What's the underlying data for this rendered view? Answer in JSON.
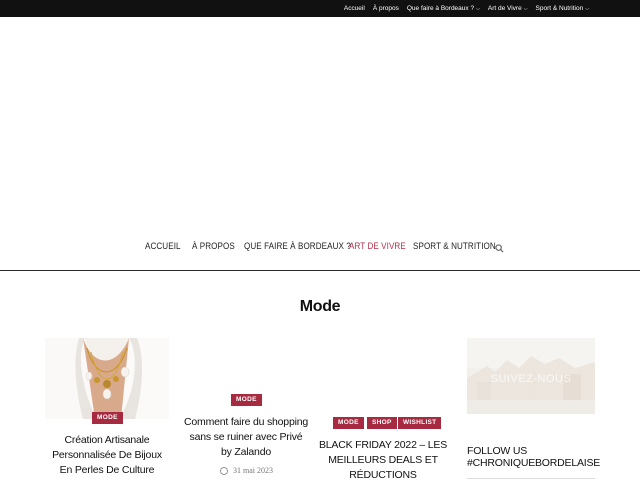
{
  "topbar": {
    "items": [
      {
        "label": "Accueil",
        "has_dropdown": false
      },
      {
        "label": "À propos",
        "has_dropdown": false
      },
      {
        "label": "Que faire à Bordeaux ?",
        "has_dropdown": true
      },
      {
        "label": "Art de Vivre",
        "has_dropdown": true
      },
      {
        "label": "Sport & Nutrition",
        "has_dropdown": true
      }
    ]
  },
  "mainnav": {
    "items": [
      {
        "label": "ACCUEIL"
      },
      {
        "label": "À PROPOS"
      },
      {
        "label": "QUE FAIRE À BORDEAUX ?"
      },
      {
        "label": "ART DE VIVRE",
        "active": true
      },
      {
        "label": "SPORT & NUTRITION"
      }
    ],
    "search_icon": "search-icon"
  },
  "page": {
    "title": "Mode"
  },
  "posts": [
    {
      "tags": [
        "MODE"
      ],
      "title": "Création Artisanale Personnalisée De Bijoux En Perles De Culture",
      "has_image": true
    },
    {
      "tags": [
        "MODE"
      ],
      "title": "Comment faire du shopping sans se ruiner avec Privé by Zalando",
      "date": "31 mai 2023",
      "has_image": false
    },
    {
      "tags": [
        "MODE",
        "SHOP",
        "WISHLIST"
      ],
      "title": "BLACK FRIDAY 2022 – LES MEILLEURS DEALS ET RÉDUCTIONS",
      "has_image": false
    }
  ],
  "sidebar": {
    "image_caption": "SUIVEZ-NOUS",
    "follow_title": "FOLLOW US #CHRONIQUEBORDELAISE"
  },
  "colors": {
    "accent": "#a62b40",
    "active_nav": "#b3314c",
    "topbar_bg": "#111111"
  }
}
